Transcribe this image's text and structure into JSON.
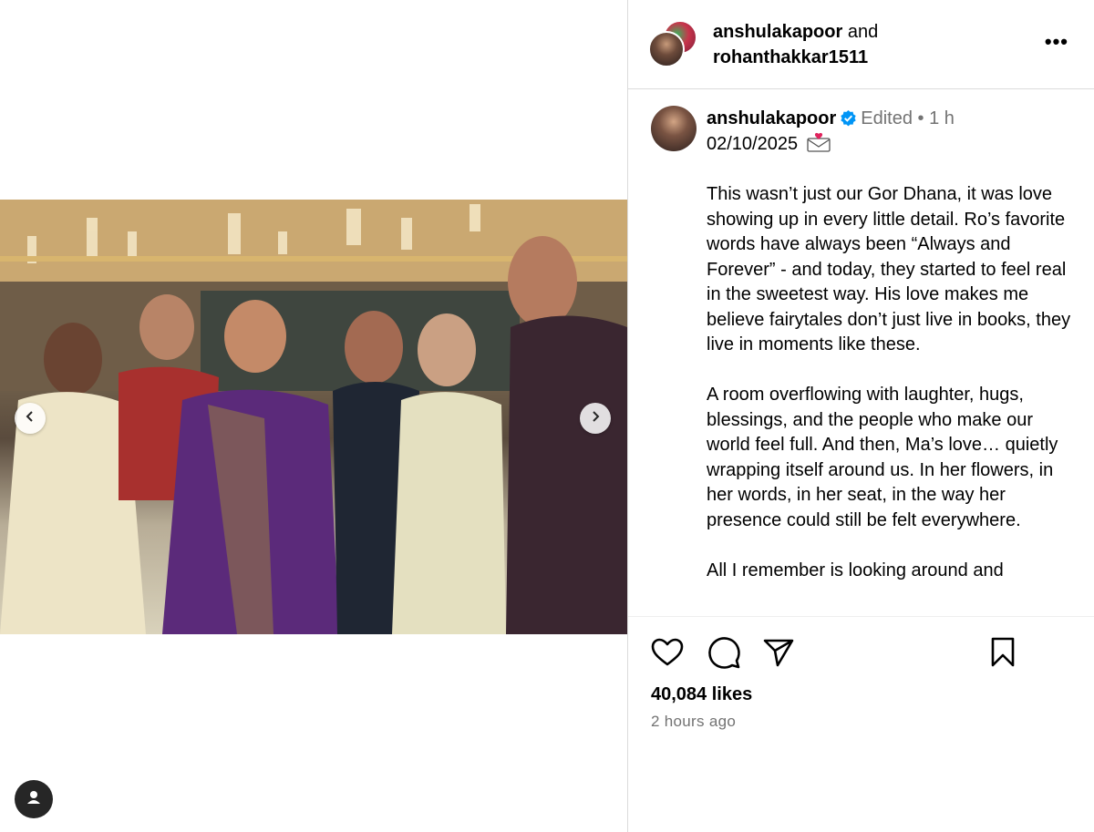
{
  "header": {
    "user1": "anshulakapoor",
    "joiner": " and",
    "user2": "rohanthakkar1511",
    "more_label": "•••"
  },
  "caption": {
    "username": "anshulakapoor",
    "edited": "Edited",
    "separator": "•",
    "age": "1 h",
    "date": "02/10/2025",
    "date_emoji_icon": "love-letter-icon",
    "body": "This wasn’t just our Gor Dhana, it was love showing up in every little detail. Ro’s favorite words have always been “Always and Forever” - and today, they started to feel real in the sweetest way. His love makes me believe fairytales don’t just live in books, they live in moments like these.\n\nA room overflowing with laughter, hugs, blessings, and the people who make our world feel full. And then, Ma’s love… quietly wrapping itself around us. In her flowers, in her words, in her seat, in the way her presence could still be felt everywhere.\n\nAll I remember is looking around and"
  },
  "stats": {
    "likes": "40,084 likes",
    "posted": "2 hours ago"
  },
  "colors": {
    "verified": "#0095f6",
    "muted": "#737373",
    "divider": "#dbdbdb"
  }
}
